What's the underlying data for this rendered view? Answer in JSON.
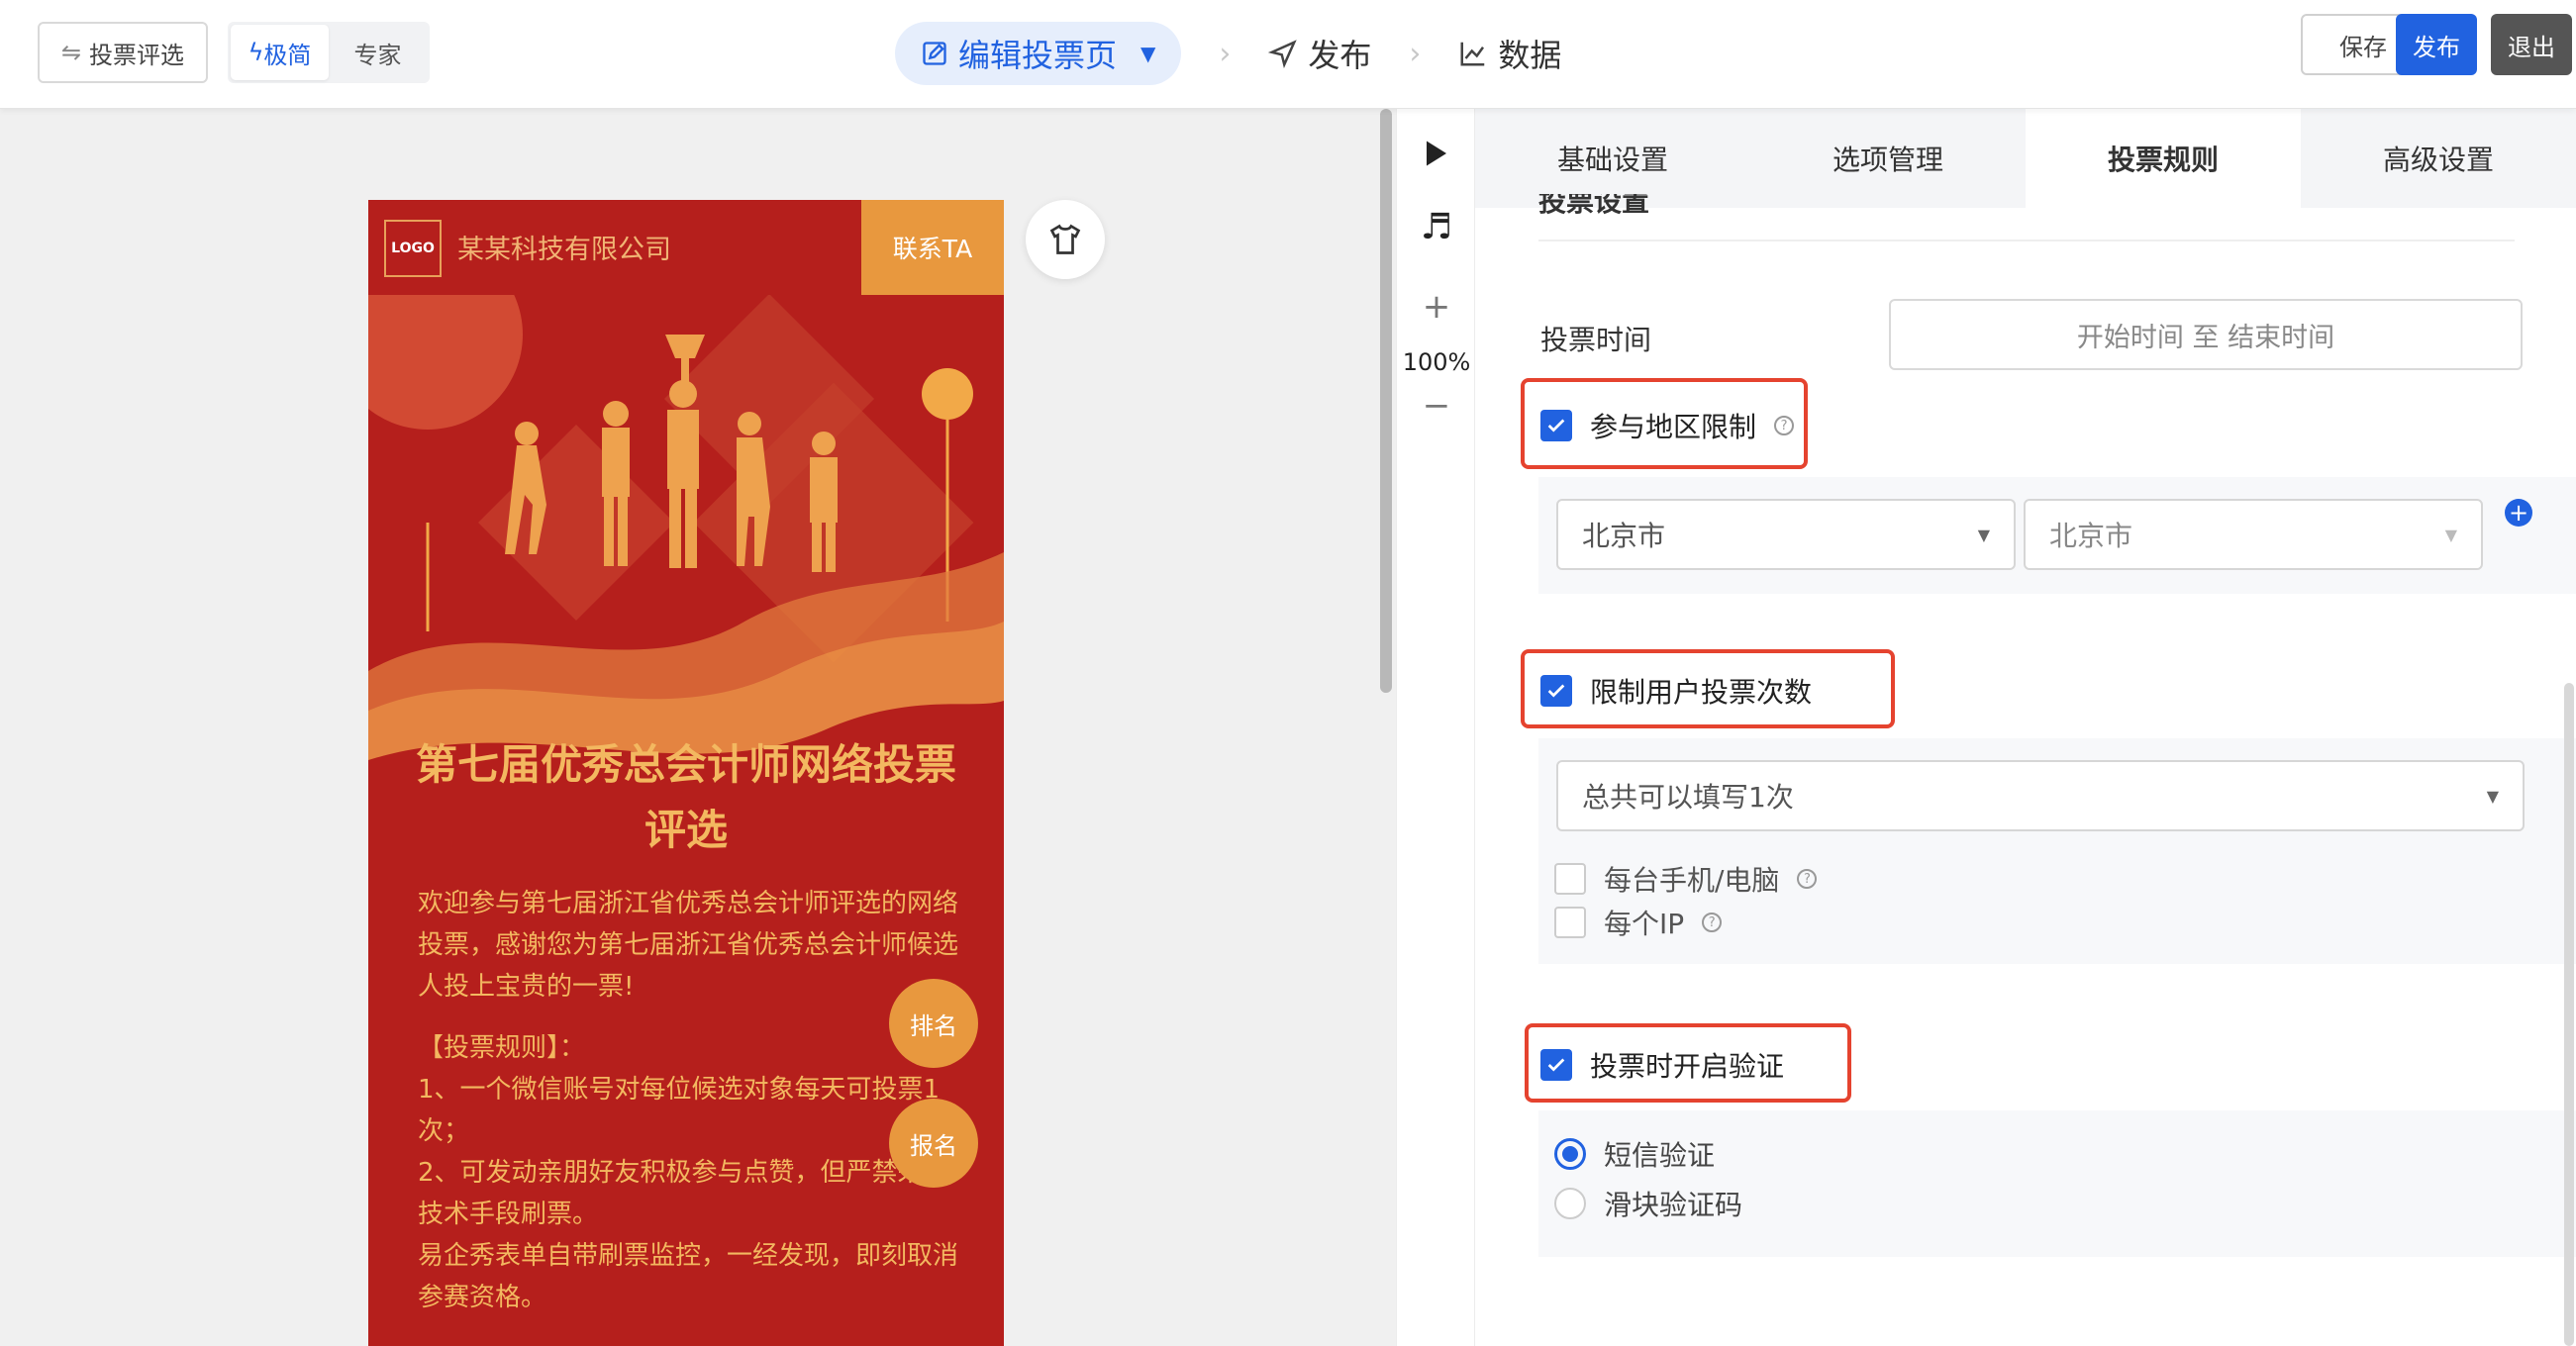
{
  "topbar": {
    "back_label": "投票评选",
    "mode_simple": "极简",
    "mode_expert": "专家",
    "step_edit": "编辑投票页",
    "step_publish": "发布",
    "step_data": "数据",
    "save_label": "保存",
    "publish_label": "发布",
    "exit_label": "退出"
  },
  "phone": {
    "logo_text": "LOGO",
    "company": "某某科技有限公司",
    "contact": "联系TA",
    "title": "第七届优秀总会计师网络投票评选",
    "description": "欢迎参与第七届浙江省优秀总会计师评选的网络投票，感谢您为第七届浙江省优秀总会计师候选人投上宝贵的一票!",
    "rules_heading": "【投票规则】：",
    "rules": [
      "1、一个微信账号对每位候选对象每天可投票1次；",
      "2、可发动亲朋好友积极参与点赞，但严禁采取技术手段刷票。",
      "易企秀表单自带刷票监控，一经发现，即刻取消参赛资格。"
    ],
    "rank_btn": "排名",
    "signup_btn": "报名"
  },
  "toolbar": {
    "zoom": "100%",
    "plus": "+",
    "minus": "−"
  },
  "panel": {
    "tabs": [
      "基础设置",
      "选项管理",
      "投票规则",
      "高级设置"
    ],
    "active_tab": "投票规则",
    "section_title": "投票设置",
    "vote_time_label": "投票时间",
    "vote_time_placeholder": "开始时间  至  结束时间",
    "region_limit_label": "参与地区限制",
    "province": "北京市",
    "city": "北京市",
    "limit_count_label": "限制用户投票次数",
    "count_option": "总共可以填写1次",
    "per_device_label": "每台手机/电脑",
    "per_ip_label": "每个IP",
    "verify_label": "投票时开启验证",
    "verify_sms": "短信验证",
    "verify_slider": "滑块验证码"
  },
  "colors": {
    "accent": "#2162e0",
    "highlight": "#e5432f",
    "phone_bg": "#b51f1c",
    "gold": "#f3b860"
  }
}
